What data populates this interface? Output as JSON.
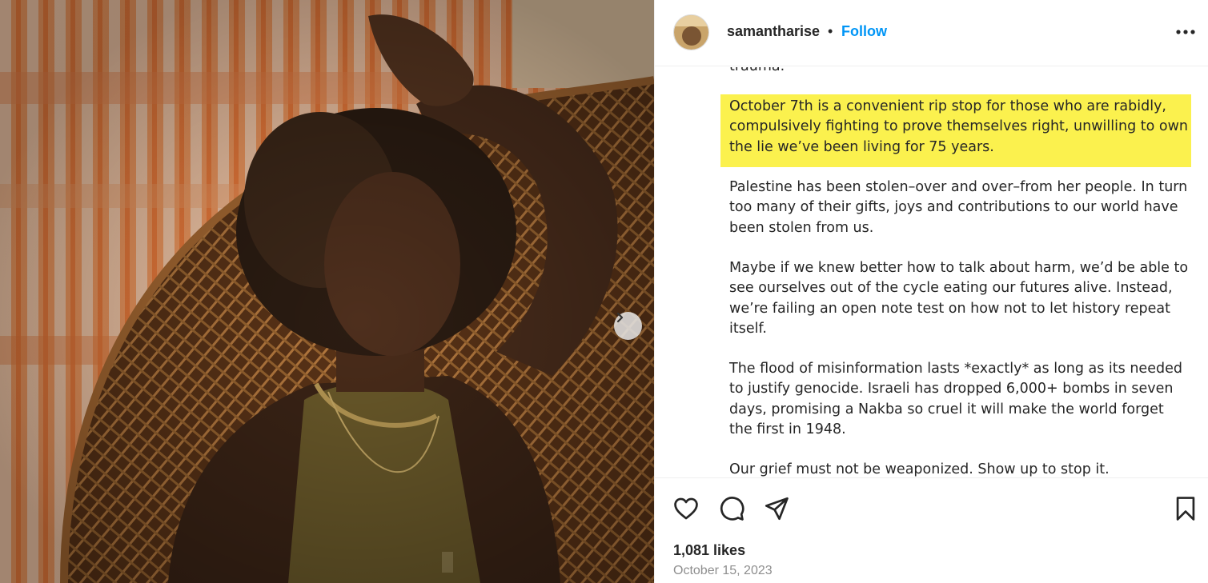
{
  "post": {
    "username": "samantharise",
    "separator": "•",
    "follow_label": "Follow",
    "more_icon": "more-options-icon"
  },
  "caption": {
    "fragment_top": "trauma.",
    "highlighted": "October 7th is a convenient rip stop for those who are rabidly, compulsively fighting to prove themselves right, unwilling to own the lie we’ve been living for 75 years.",
    "p2": "Palestine has been stolen–over and over–from her people. In turn too many of their gifts, joys and contributions to our world have been stolen from us.",
    "p3": "Maybe if we knew better how to talk about harm, we’d be able to see ourselves out of the cycle eating our futures alive. Instead, we’re failing an open note test on how not to let history repeat itself.",
    "p4": "The flood of misinformation lasts *exactly* as long as its needed to justify genocide. Israeli has dropped 6,000+ bombs in seven days, promising a Nakba so cruel it will make the world forget the first in 1948.",
    "p5": "Our grief must not be weaponized. Show up to stop it."
  },
  "actions": {
    "like_icon": "heart-icon",
    "comment_icon": "comment-icon",
    "share_icon": "share-icon",
    "save_icon": "bookmark-icon"
  },
  "stats": {
    "likes": "1,081 likes",
    "date": "October 15, 2023"
  },
  "colors": {
    "follow": "#0095f6",
    "highlight": "#fbf14e",
    "text": "#262626",
    "muted": "#8e8e8e"
  }
}
